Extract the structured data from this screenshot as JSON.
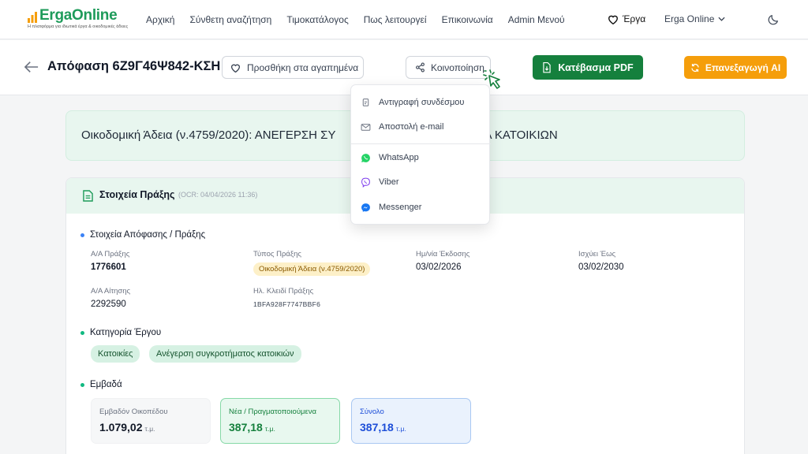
{
  "brand": {
    "name": "ErgaOnline",
    "tagline": "Η πλατφόρμα για ιδιωτικά έργα & οικοδομικές άδειες",
    "color": "#1e9b5a"
  },
  "nav": {
    "links": [
      "Αρχική",
      "Σύνθετη αναζήτηση",
      "Τιμοκατάλογος",
      "Πως λειτουργεί",
      "Επικοινωνία",
      "Admin Μενού"
    ],
    "erga_label": "Έργα",
    "org_label": "Erga Online"
  },
  "header": {
    "title": "Απόφαση 6Ζ9Γ46Ψ842-ΚΣΗ",
    "favorite_label": "Προσθήκη στα αγαπημένα",
    "share_label": "Κοινοποίηση",
    "pdf_label": "Κατέβασμα PDF",
    "ai_label": "Επανεξαγωγή AI"
  },
  "share_menu": {
    "items": [
      {
        "label": "Αντιγραφή συνδέσμου",
        "icon": "copy-link-icon"
      },
      {
        "label": "Αποστολή e-mail",
        "icon": "mail-icon"
      },
      {
        "label": "WhatsApp",
        "icon": "whatsapp-icon"
      },
      {
        "label": "Viber",
        "icon": "viber-icon"
      },
      {
        "label": "Messenger",
        "icon": "messenger-icon"
      }
    ]
  },
  "banner": {
    "text": "Οικοδομική Άδεια (ν.4759/2020): ΑΝΕΓΕΡΣΗ ΣΥ",
    "text_tail": "Α ΚΑΤΟΙΚΙΩΝ"
  },
  "card": {
    "title": "Στοιχεία Πράξης",
    "ocr": "(OCR: 04/04/2026 11:36)",
    "section_decision": "Στοιχεία Απόφασης / Πράξης",
    "fields": {
      "aa_praxis_label": "Α/Α Πράξης",
      "aa_praxis_value": "1776601",
      "typos_label": "Τύπος Πράξης",
      "typos_value": "Οικοδομική Άδεια (ν.4759/2020)",
      "issue_label": "Ημ/νία Έκδοσης",
      "issue_value": "03/02/2026",
      "valid_label": "Ισχύει Έως",
      "valid_value": "03/02/2030",
      "aa_aitisis_label": "Α/Α Αίτησης",
      "aa_aitisis_value": "2292590",
      "key_label": "Ηλ. Κλειδί Πράξης",
      "key_value": "1BFA928F7747BBF6"
    },
    "section_category": "Κατηγορία Έργου",
    "categories": [
      "Κατοικίες",
      "Ανέγερση συγκροτήματος κατοικιών"
    ],
    "section_areas": "Εμβαδά",
    "areas": [
      {
        "label": "Εμβαδόν Οικοπέδου",
        "value": "1.079,02",
        "unit": "τ.μ."
      },
      {
        "label": "Νέα / Πραγματοποιούμενα",
        "value": "387,18",
        "unit": "τ.μ."
      },
      {
        "label": "Σύνολο",
        "value": "387,18",
        "unit": "τ.μ."
      }
    ]
  },
  "colors": {
    "primary_green": "#15803d",
    "amber": "#f59e0b",
    "mint": "#e8f6ef"
  }
}
